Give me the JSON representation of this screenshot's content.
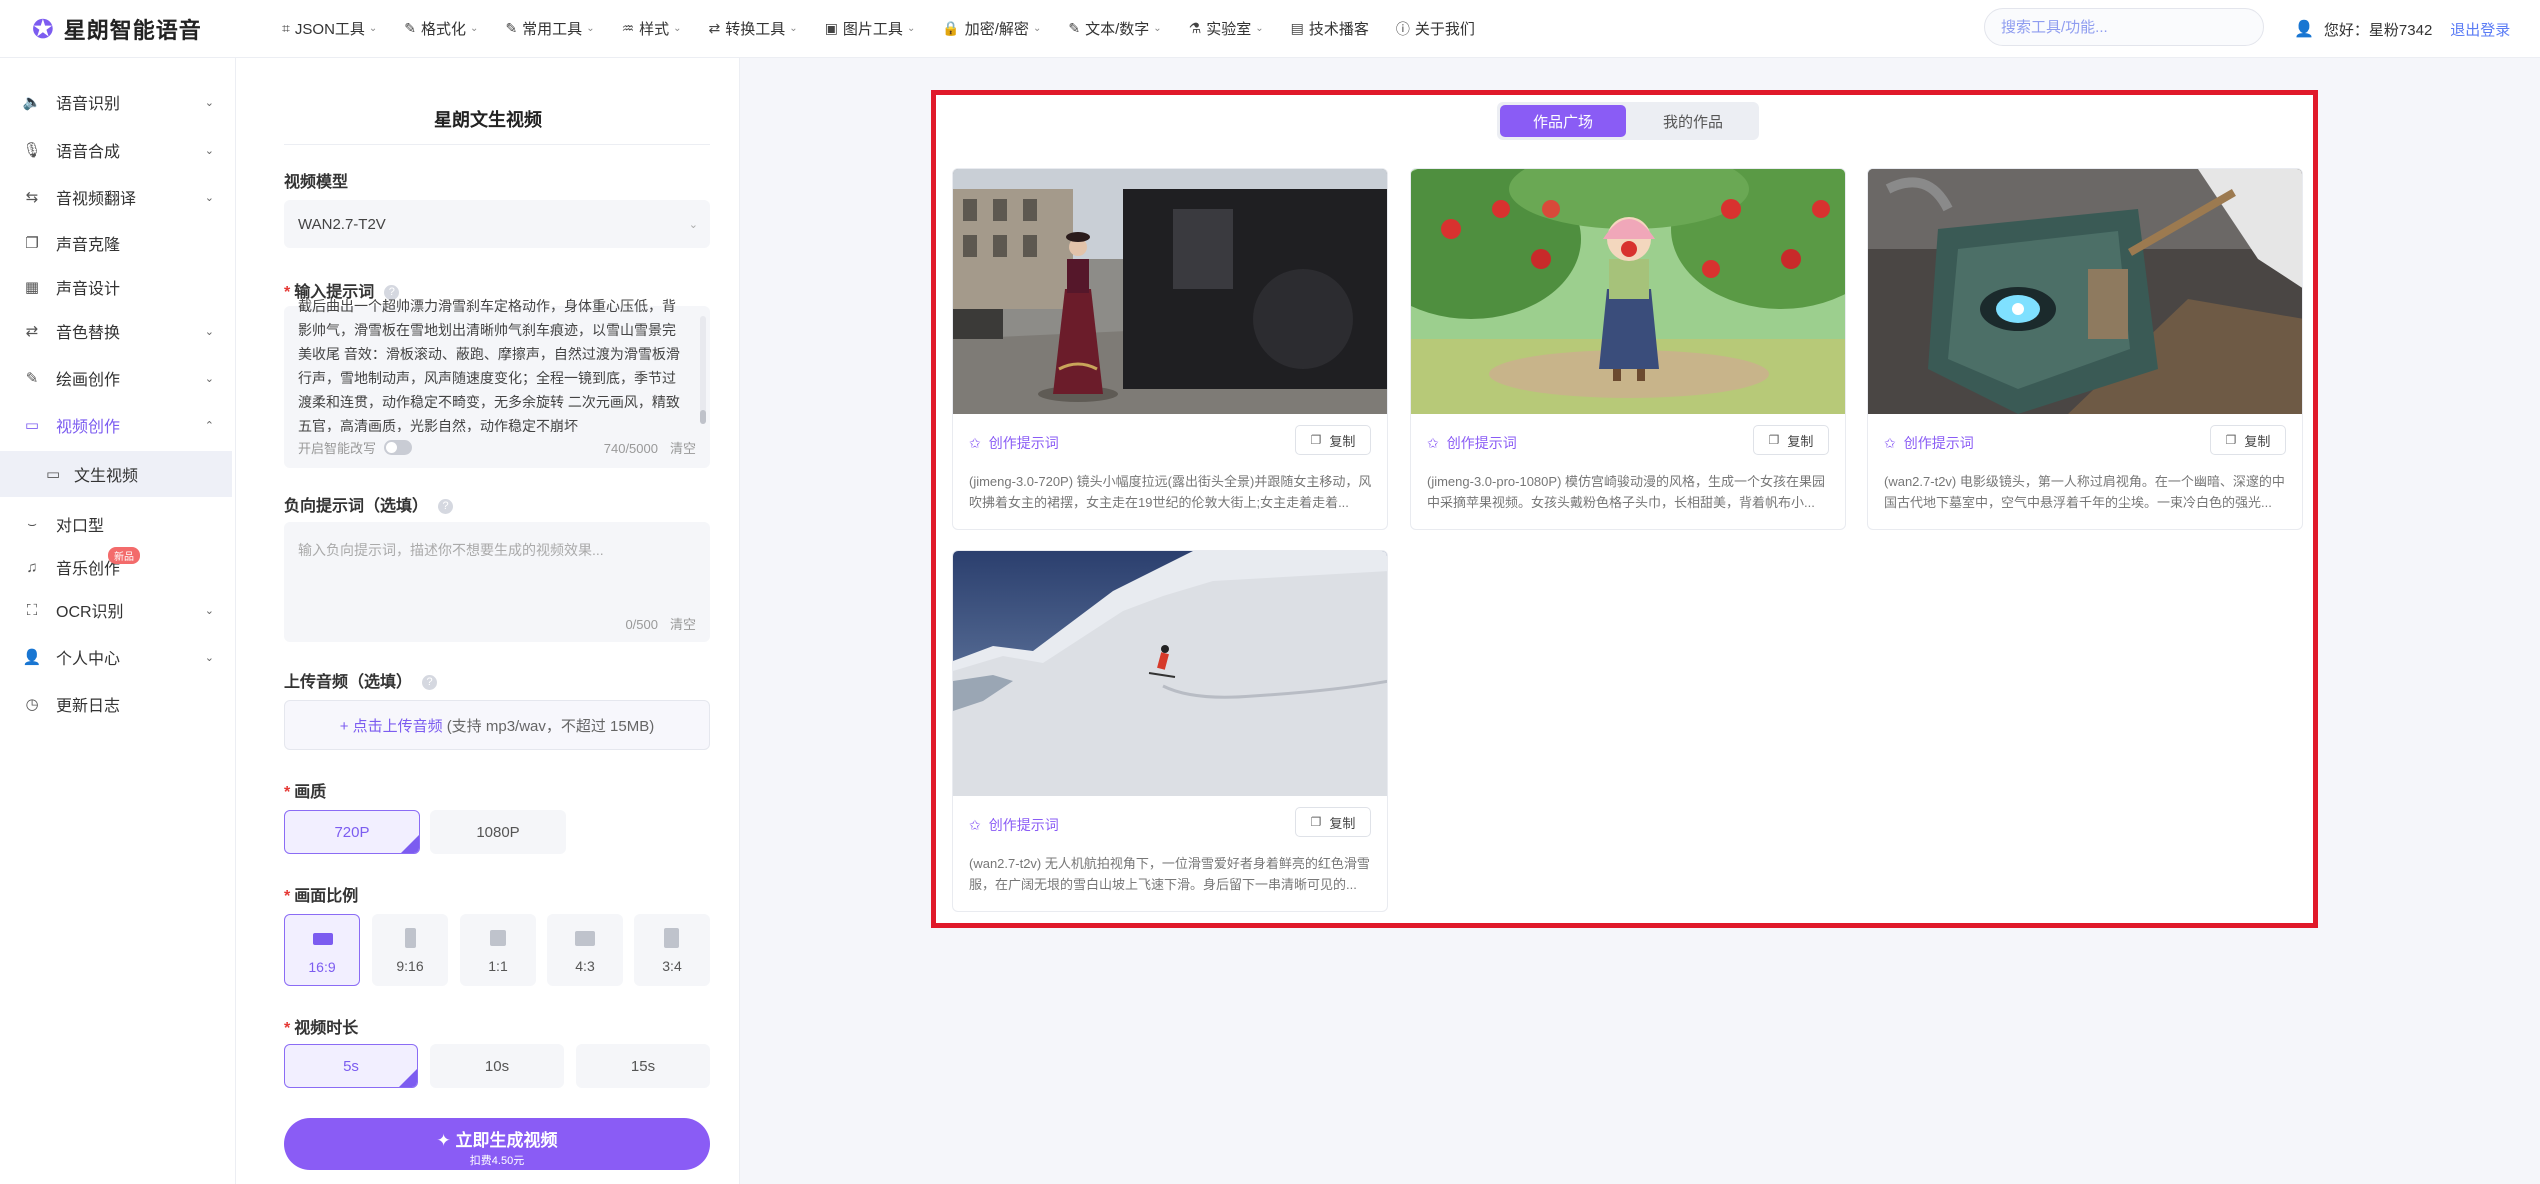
{
  "app": {
    "name": "星朗智能语音"
  },
  "nav": [
    {
      "label": "JSON工具",
      "icon": "json-icon",
      "glyph": "⌗"
    },
    {
      "label": "格式化",
      "icon": "format-icon",
      "glyph": "✎"
    },
    {
      "label": "常用工具",
      "icon": "tools-icon",
      "glyph": "✎"
    },
    {
      "label": "样式",
      "icon": "style-icon",
      "glyph": "♒"
    },
    {
      "label": "转换工具",
      "icon": "convert-icon",
      "glyph": "⇄"
    },
    {
      "label": "图片工具",
      "icon": "image-icon",
      "glyph": "▣"
    },
    {
      "label": "加密/解密",
      "icon": "lock-icon",
      "glyph": "🔒"
    },
    {
      "label": "文本/数字",
      "icon": "text-icon",
      "glyph": "✎"
    },
    {
      "label": "实验室",
      "icon": "lab-icon",
      "glyph": "⚗"
    },
    {
      "label": "技术播客",
      "icon": "podcast-icon",
      "glyph": "▤"
    },
    {
      "label": "关于我们",
      "icon": "info-icon",
      "glyph": "ⓘ"
    }
  ],
  "search": {
    "placeholder": "搜索工具/功能..."
  },
  "user": {
    "greeting": "您好：星粉7342",
    "logout": "退出登录"
  },
  "sidebar": {
    "items": [
      {
        "label": "语音识别",
        "icon": "speaker-icon",
        "glyph": "🔈",
        "chevron": "⌄"
      },
      {
        "label": "语音合成",
        "icon": "microphone-icon",
        "glyph": "🎙",
        "chevron": "⌄"
      },
      {
        "label": "音视频翻译",
        "icon": "translate-icon",
        "glyph": "⇆",
        "chevron": "⌄"
      },
      {
        "label": "声音克隆",
        "icon": "clone-icon",
        "glyph": "❐",
        "chevron": ""
      },
      {
        "label": "声音设计",
        "icon": "design-icon",
        "glyph": "▦",
        "chevron": ""
      },
      {
        "label": "音色替换",
        "icon": "swap-icon",
        "glyph": "⇄",
        "chevron": "⌄"
      },
      {
        "label": "绘画创作",
        "icon": "paint-icon",
        "glyph": "✎",
        "chevron": "⌄"
      },
      {
        "label": "视频创作",
        "icon": "video-icon",
        "glyph": "▭",
        "chevron": "⌃"
      },
      {
        "label": "对口型",
        "icon": "lipsync-icon",
        "glyph": "⌣",
        "chevron": ""
      },
      {
        "label": "音乐创作",
        "icon": "music-icon",
        "glyph": "♫",
        "chevron": "",
        "badge": "新品"
      },
      {
        "label": "OCR识别",
        "icon": "scan-icon",
        "glyph": "⛶",
        "chevron": "⌄"
      },
      {
        "label": "个人中心",
        "icon": "user-icon",
        "glyph": "👤",
        "chevron": "⌄"
      },
      {
        "label": "更新日志",
        "icon": "clock-icon",
        "glyph": "◷",
        "chevron": ""
      }
    ],
    "sub": {
      "label": "文生视频",
      "icon": "film-icon",
      "glyph": "▭"
    }
  },
  "form": {
    "title": "星朗文生视频",
    "model_label": "视频模型",
    "model_value": "WAN2.7-T2V",
    "prompt_label": "输入提示词",
    "prompt_text": "截后曲出一个超帅漂力滑雪刹车定格动作，身体重心压低，背影帅气，滑雪板在雪地划出清晰帅气刹车痕迹，以雪山雪景完美收尾 音效：滑板滚动、蔽跑、摩擦声，自然过渡为滑雪板滑行声，雪地制动声，风声随速度变化；全程一镜到底，季节过渡柔和连贯，动作稳定不畸变，无多余旋转 二次元画风，精致五官，高清画质，光影自然，动作稳定不崩坏",
    "smart_label": "开启智能改写",
    "prompt_count": "740/5000",
    "clear": "清空",
    "negative_label": "负向提示词（选填）",
    "negative_placeholder": "输入负向提示词，描述你不想要生成的视频效果...",
    "negative_count": "0/500",
    "audio_label": "上传音频（选填）",
    "audio_link": "+ 点击上传音频",
    "audio_hint": "(支持 mp3/wav，不超过 15MB)",
    "quality_label": "画质",
    "quality_options": [
      "720P",
      "1080P"
    ],
    "ratio_label": "画面比例",
    "ratio_options": [
      "16:9",
      "9:16",
      "1:1",
      "4:3",
      "3:4"
    ],
    "duration_label": "视频时长",
    "duration_options": [
      "5s",
      "10s",
      "15s"
    ],
    "generate_label": "✦ 立即生成视频",
    "generate_cost": "扣费4.50元"
  },
  "gallery": {
    "tabs": [
      "作品广场",
      "我的作品"
    ],
    "prompt_label": "创作提示词",
    "copy_label": "复制",
    "cards": [
      {
        "desc": "(jimeng-3.0-720P) 镜头小幅度拉远(露出街头全景)并跟随女主移动，风吹拂着女主的裙摆，女主走在19世纪的伦敦大街上;女主走着走着..."
      },
      {
        "desc": "(jimeng-3.0-pro-1080P) 模仿宫崎骏动漫的风格，生成一个女孩在果园中采摘苹果视频。女孩头戴粉色格子头巾，长相甜美，背着帆布小..."
      },
      {
        "desc": "(wan2.7-t2v) 电影级镜头，第一人称过肩视角。在一个幽暗、深邃的中国古代地下墓室中，空气中悬浮着千年的尘埃。一束冷白色的强光..."
      },
      {
        "desc": "(wan2.7-t2v) 无人机航拍视角下，一位滑雪爱好者身着鲜亮的红色滑雪服，在广阔无垠的雪白山坡上飞速下滑。身后留下一串清晰可见的..."
      }
    ]
  },
  "colors": {
    "accent": "#8a5cf5",
    "highlight_frame": "#e0192a",
    "logout": "#5b7cf5"
  }
}
